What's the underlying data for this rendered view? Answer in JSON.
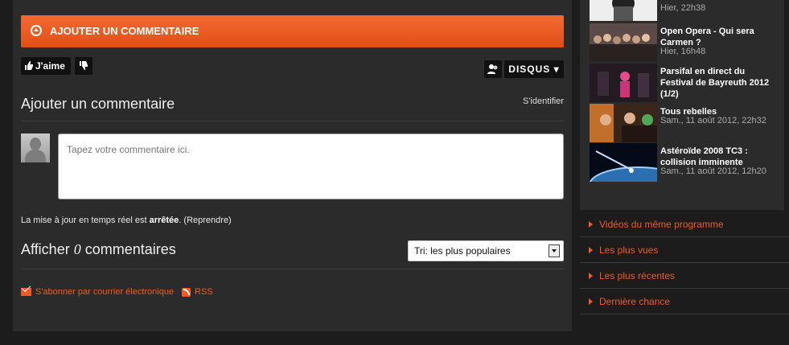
{
  "comments": {
    "add_bar_label": "AJOUTER UN COMMENTAIRE",
    "like_label": "J'aime",
    "disqus_label": "DISQUS",
    "add_title": "Ajouter un commentaire",
    "signin_label": "S'identifier",
    "comment_placeholder": "Tapez votre commentaire ici.",
    "realtime_prefix": "La mise à jour en temps réel est",
    "realtime_status": "arrêtée",
    "realtime_action": "(Reprendre)",
    "show_title_prefix": "Afficher",
    "show_count": "0",
    "show_title_suffix": "commentaires",
    "sort_selected": "Tri: les plus populaires",
    "subscribe_label": "S'abonner par courrier électronique",
    "rss_label": "RSS"
  },
  "sidebar": {
    "videos": [
      {
        "title": "",
        "date": "Hier, 22h38"
      },
      {
        "title": "Open Opera - Qui sera Carmen ?",
        "date": "Hier, 16h48"
      },
      {
        "title": "Parsifal en direct du Festival de Bayreuth 2012 (1/2)",
        "date": ""
      },
      {
        "title": "Tous rebelles",
        "date": "Sam., 11 août 2012, 22h32"
      },
      {
        "title": "Astéroïde 2008 TC3 : collision imminente",
        "date": "Sam., 11 août 2012, 12h20"
      }
    ],
    "links": [
      "Vidéos du même programme",
      "Les plus vues",
      "Les plus récentes",
      "Dernière chance"
    ]
  }
}
